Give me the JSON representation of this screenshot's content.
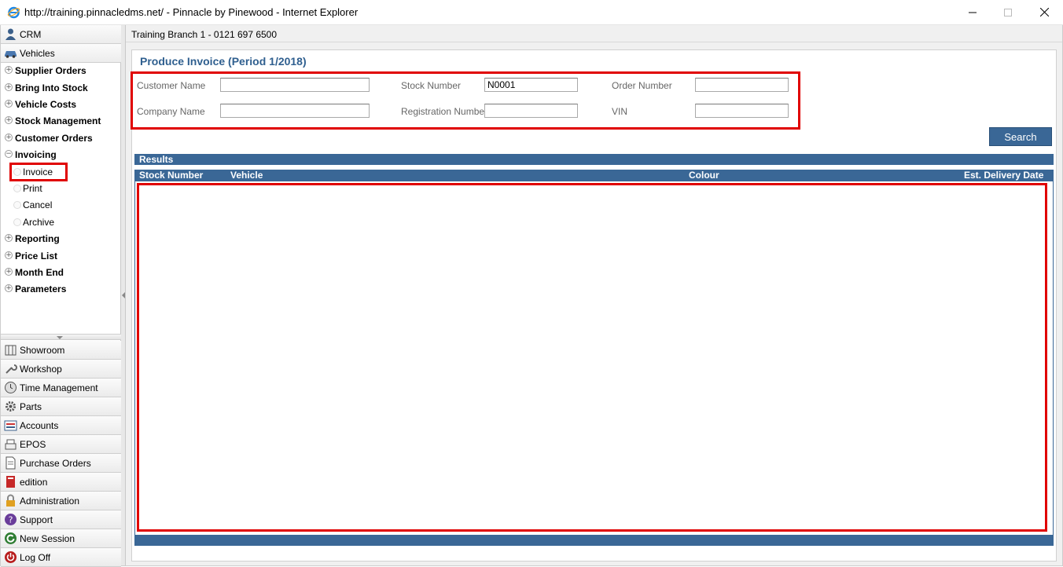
{
  "window": {
    "title": "http://training.pinnacledms.net/ - Pinnacle by Pinewood - Internet Explorer"
  },
  "sidebar": {
    "top_items": [
      {
        "label": "CRM",
        "icon": "person-icon"
      },
      {
        "label": "Vehicles",
        "icon": "car-icon"
      }
    ],
    "tree": [
      {
        "label": "Supplier Orders",
        "expander": "+"
      },
      {
        "label": "Bring Into Stock",
        "expander": "+"
      },
      {
        "label": "Vehicle Costs",
        "expander": "+"
      },
      {
        "label": "Stock Management",
        "expander": "+"
      },
      {
        "label": "Customer Orders",
        "expander": "+"
      },
      {
        "label": "Invoicing",
        "expander": "−"
      }
    ],
    "invoicing_sub": [
      {
        "label": "Invoice"
      },
      {
        "label": "Print"
      },
      {
        "label": "Cancel"
      },
      {
        "label": "Archive"
      }
    ],
    "tree_after": [
      {
        "label": "Reporting",
        "expander": "+"
      },
      {
        "label": "Price List",
        "expander": "+"
      },
      {
        "label": "Month End",
        "expander": "+"
      },
      {
        "label": "Parameters",
        "expander": "+"
      }
    ],
    "bottom_items": [
      {
        "label": "Showroom",
        "icon": "showroom-icon"
      },
      {
        "label": "Workshop",
        "icon": "wrench-icon"
      },
      {
        "label": "Time Management",
        "icon": "clock-icon"
      },
      {
        "label": "Parts",
        "icon": "gear-icon"
      },
      {
        "label": "Accounts",
        "icon": "ledger-icon"
      },
      {
        "label": "EPOS",
        "icon": "till-icon"
      },
      {
        "label": "Purchase Orders",
        "icon": "document-icon"
      },
      {
        "label": "edition",
        "icon": "book-icon"
      },
      {
        "label": "Administration",
        "icon": "lock-icon"
      },
      {
        "label": "Support",
        "icon": "support-icon"
      },
      {
        "label": "New Session",
        "icon": "new-session-icon"
      },
      {
        "label": "Log Off",
        "icon": "power-icon"
      }
    ]
  },
  "header": {
    "branch": "Training Branch 1 - 0121 697 6500"
  },
  "form": {
    "page_title": "Produce Invoice (Period 1/2018)",
    "customer_name_label": "Customer Name",
    "customer_name_value": "",
    "company_name_label": "Company Name",
    "company_name_value": "",
    "stock_number_label": "Stock Number",
    "stock_number_value": "N0001",
    "registration_number_label": "Registration Number",
    "registration_number_value": "",
    "order_number_label": "Order Number",
    "order_number_value": "",
    "vin_label": "VIN",
    "vin_value": "",
    "search_label": "Search"
  },
  "results": {
    "title": "Results",
    "columns": [
      "Stock Number",
      "Vehicle",
      "Colour",
      "Est. Delivery Date"
    ],
    "rows": []
  },
  "colors": {
    "accent": "#3a6796",
    "highlight": "#e00000",
    "title": "#2f5f8f"
  }
}
